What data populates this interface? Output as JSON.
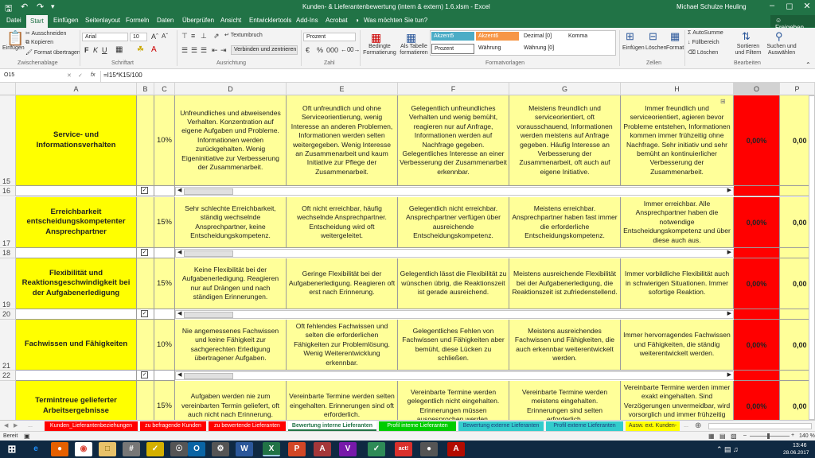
{
  "window": {
    "title": "Kunden- & Lieferantenbewertung (intern & extern) 1.6.xlsm  -  Excel",
    "user": "Michael Schulze Heuling"
  },
  "tabs": [
    "Datei",
    "Start",
    "Einfügen",
    "Seitenlayout",
    "Formeln",
    "Daten",
    "Überprüfen",
    "Ansicht",
    "Entwicklertools",
    "Add-Ins",
    "Acrobat",
    "Was möchten Sie tun?"
  ],
  "share_label": "Freigeben",
  "ribbon": {
    "paste": "Einfügen",
    "cut": "Ausschneiden",
    "copy": "Kopieren",
    "format_painter": "Format übertragen",
    "font_name": "Arial",
    "font_size": "10",
    "wrap_text": "Textumbruch",
    "merge": "Verbinden und zentrieren",
    "number_format": "Prozent",
    "cond_format": "Bedingte Formatierung",
    "as_table": "Als Tabelle formatieren",
    "styles": [
      "Akzent5",
      "Akzent6",
      "Dezimal [0]",
      "Komma",
      "Prozent",
      "Währung",
      "Währung [0]"
    ],
    "insert": "Einfügen",
    "delete": "Löschen",
    "format": "Format",
    "autosum": "AutoSumme",
    "fill": "Füllbereich",
    "clear": "Löschen",
    "sort": "Sortieren und Filtern",
    "find": "Suchen und Auswählen",
    "groups": [
      "Zwischenablage",
      "Schriftart",
      "Ausrichtung",
      "Zahl",
      "Formatvorlagen",
      "Zellen",
      "Bearbeiten"
    ]
  },
  "formula_bar": {
    "name_box": "O15",
    "fx": "fx",
    "formula": "=I15*K15/100"
  },
  "columns": [
    "A",
    "B",
    "C",
    "D",
    "E",
    "F",
    "G",
    "H",
    "O",
    "P"
  ],
  "rows": [
    {
      "top_num": "15",
      "bottom_num": "16",
      "category": "Service- und Informationsverhalten",
      "pct": "10%",
      "value": "0,00%",
      "value2": "0,00",
      "d": "Unfreundliches und abweisendes Verhalten. Konzentration auf eigene Aufgaben und Probleme. Informationen werden zurückgehalten. Wenig Eigeninitiative zur Verbesserung der Zusammenarbeit.",
      "e": "Oft unfreundlich und ohne Serviceorientierung, wenig Interesse an anderen Problemen, Informationen werden selten weitergegeben. Wenig Interesse an Zusammenarbeit und kaum Initiative zur Pflege der Zusammenarbeit.",
      "f": "Gelegentlich unfreundliches Verhalten und wenig bemüht, reagieren nur auf Anfrage, Informationen werden auf Nachfrage gegeben. Gelegentliches Interesse an einer Verbesserung der Zusammenarbeit erkennbar.",
      "g": "Meistens freundlich und serviceorientiert, oft vorausschauend, Informationen werden meistens auf Anfrage gegeben. Häufig Interesse an Verbesserung der Zusammenarbeit, oft auch auf eigene Initiative.",
      "h": "Immer freundlich und serviceorientiert, agieren bevor Probleme entstehen, Informationen kommen immer frühzeitig ohne Nachfrage. Sehr initiativ und sehr bemüht an kontinuierlicher Verbesserung der Zusammenarbeit."
    },
    {
      "top_num": "17",
      "bottom_num": "18",
      "category": "Erreichbarkeit entscheidungskompetenter Ansprechpartner",
      "pct": "15%",
      "value": "0,00%",
      "value2": "0,00",
      "d": "Sehr schlechte Erreichbarkeit, ständig wechselnde Ansprechpartner, keine Entscheidungskompetenz.",
      "e": "Oft nicht erreichbar, häufig wechselnde Ansprechpartner. Entscheidung wird oft weitergeleitet.",
      "f": "Gelegentlich nicht erreichbar. Ansprechpartner verfügen über ausreichende Entscheidungskompetenz.",
      "g": "Meistens erreichbar. Ansprechpartner haben fast immer die erforderliche Entscheidungskompetenz.",
      "h": "Immer erreichbar. Alle Ansprechpartner haben die notwendige Entscheidungskompetenz und über diese auch aus."
    },
    {
      "top_num": "19",
      "bottom_num": "20",
      "category": "Flexibilität und Reaktionsgeschwindigkeit bei der Aufgabenerledigung",
      "pct": "15%",
      "value": "0,00%",
      "value2": "0,00",
      "d": "Keine Flexibilität bei der Aufgabenerledigung. Reagieren nur auf Drängen und nach ständigen Erinnerungen.",
      "e": "Geringe Flexibilität bei der Aufgabenerledigung. Reagieren oft erst nach Erinnerung.",
      "f": "Gelegentlich lässt die Flexibilität zu wünschen übrig, die Reaktionszeit ist gerade ausreichend.",
      "g": "Meistens ausreichende Flexibilität bei der Aufgabenerledigung, die Reaktionszeit ist zufriedenstellend.",
      "h": "Immer vorbildliche Flexibilität auch in schwierigen Situationen. Immer sofortige Reaktion."
    },
    {
      "top_num": "21",
      "bottom_num": "22",
      "category": "Fachwissen und Fähigkeiten",
      "pct": "10%",
      "value": "0,00%",
      "value2": "0,00",
      "d": "Nie angemessenes Fachwissen und keine Fähigkeit zur sachgerechten Erledigung übertragener Aufgaben.",
      "e": "Oft fehlendes Fachwissen und selten die erforderlichen Fähigkeiten zur Problemlösung. Wenig Weiterentwicklung erkennbar.",
      "f": "Gelegentliches Fehlen von Fachwissen und Fähigkeiten aber bemüht, diese Lücken zu schließen.",
      "g": "Meistens ausreichendes Fachwissen und Fähigkeiten, die auch erkennbar weiterentwickelt werden.",
      "h": "Immer hervorragendes Fachwissen und Fähigkeiten, die ständig weiterentwickelt werden."
    },
    {
      "top_num": "",
      "bottom_num": "",
      "category": "Termintreue gelieferter Arbeitsergebnisse",
      "pct": "15%",
      "value": "0,00%",
      "value2": "0,00",
      "d": "Aufgaben werden nie zum vereinbarten Termin geliefert, oft auch nicht nach Erinnerung.",
      "e": "Vereinbarte Termine werden selten eingehalten. Erinnerungen sind oft erforderlich.",
      "f": "Vereinbarte Termine werden gelegentlich nicht eingehalten. Erinnerungen müssen ausgesprochen werden.",
      "g": "Vereinbarte Termine werden meistens eingehalten. Erinnerungen sind selten erforderlich.",
      "h": "Vereinbarte Termine werden immer exakt eingehalten. Sind Verzögerungen unvermeidbar, wird vorsorglich und immer frühzeitig informiert."
    }
  ],
  "sheet_tabs": [
    {
      "label": "Kunden_Lieferantenbeziehungen",
      "bg": "#ff0000",
      "fg": "#ffffff"
    },
    {
      "label": "zu befragende Kunden",
      "bg": "#ff0000",
      "fg": "#ffffff"
    },
    {
      "label": "zu bewertende Lieferanten",
      "bg": "#ff0000",
      "fg": "#ffffff"
    },
    {
      "label": "Bewertung interne Lieferanten",
      "bg": "#ffffff",
      "fg": "#217346"
    },
    {
      "label": "Profil interne Lieferanten",
      "bg": "#00cc00",
      "fg": "#ffffff"
    },
    {
      "label": "Bewertung externe Lieferanten",
      "bg": "#33cccc",
      "fg": "#1f3f7f"
    },
    {
      "label": "Profil externe Lieferanten",
      "bg": "#33cccc",
      "fg": "#1f3f7f"
    },
    {
      "label": "Ausw. ext. Kunden-",
      "bg": "#ffff00",
      "fg": "#333333"
    }
  ],
  "status": {
    "ready": "Bereit",
    "zoom": "140 %"
  },
  "taskbar": {
    "time": "13:46",
    "date": "28.06.2017"
  },
  "colors": {
    "excel_green": "#217346",
    "yellow_light": "#ffff99",
    "yellow": "#ffff00",
    "red": "#ff0000"
  }
}
